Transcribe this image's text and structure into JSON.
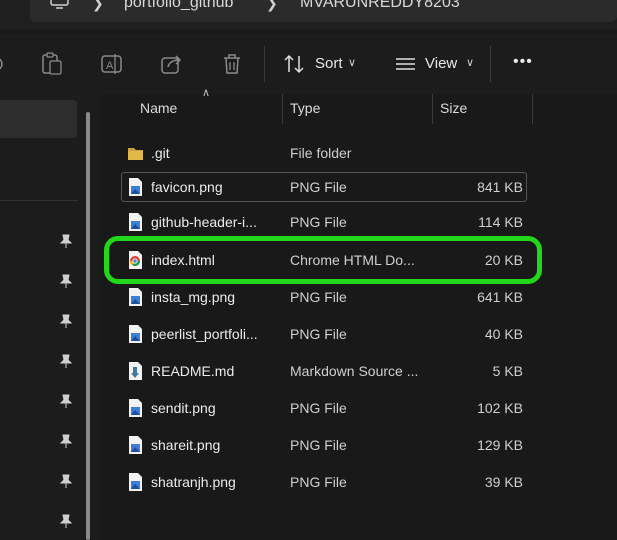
{
  "address": {
    "crumbs": [
      "portfolio_github",
      "MVARUNREDDY8203"
    ]
  },
  "toolbar": {
    "sort_label": "Sort",
    "view_label": "View",
    "more_label": "•••"
  },
  "columns": {
    "name": "Name",
    "type": "Type",
    "size": "Size"
  },
  "files": [
    {
      "name": ".git",
      "type": "File folder",
      "size": "",
      "icon": "folder-icon"
    },
    {
      "name": "favicon.png",
      "type": "PNG File",
      "size": "841 KB",
      "icon": "image-file-icon"
    },
    {
      "name": "github-header-i...",
      "type": "PNG File",
      "size": "114 KB",
      "icon": "image-file-icon"
    },
    {
      "name": "index.html",
      "type": "Chrome HTML Do...",
      "size": "20 KB",
      "icon": "chrome-html-icon"
    },
    {
      "name": "insta_mg.png",
      "type": "PNG File",
      "size": "641 KB",
      "icon": "image-file-icon"
    },
    {
      "name": "peerlist_portfoli...",
      "type": "PNG File",
      "size": "40 KB",
      "icon": "image-file-icon"
    },
    {
      "name": "README.md",
      "type": "Markdown Source ...",
      "size": "5 KB",
      "icon": "markdown-file-icon"
    },
    {
      "name": "sendit.png",
      "type": "PNG File",
      "size": "102 KB",
      "icon": "image-file-icon"
    },
    {
      "name": "shareit.png",
      "type": "PNG File",
      "size": "129 KB",
      "icon": "image-file-icon"
    },
    {
      "name": "shatranjh.png",
      "type": "PNG File",
      "size": "39 KB",
      "icon": "image-file-icon"
    }
  ],
  "highlight_color": "#22d61a"
}
